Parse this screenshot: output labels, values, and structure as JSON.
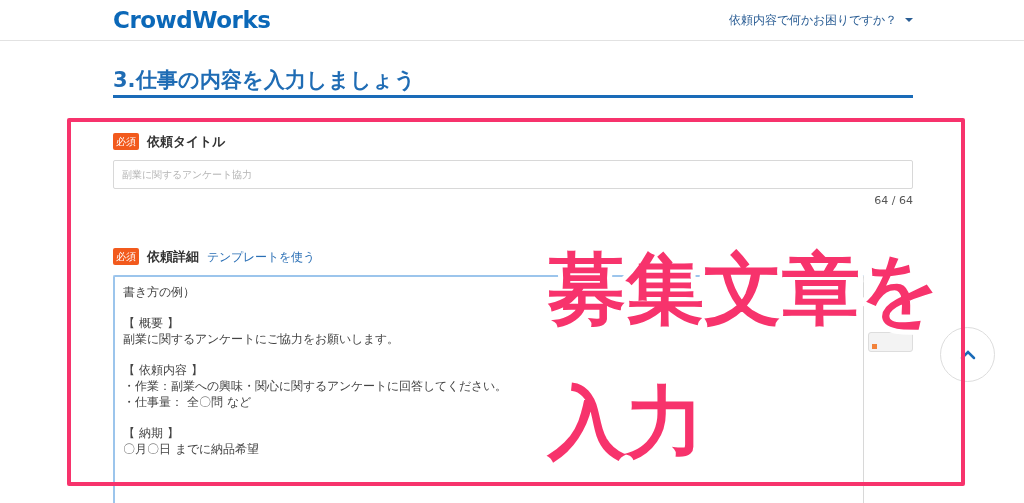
{
  "header": {
    "logo": "CrowdWorks",
    "help_menu": "依頼内容で何かお困りですか？"
  },
  "heading": "3.仕事の内容を入力しましょう",
  "fields": [
    {
      "kind": "input",
      "required_badge": "必須",
      "label": "依頼タイトル",
      "placeholder": "副業に関するアンケート協力",
      "counter": "64 / 64"
    },
    {
      "kind": "textarea",
      "required_badge": "必須",
      "label": "依頼詳細",
      "link": "テンプレートを使う",
      "paragraphs": [
        [
          "書き方の例）"
        ],
        [
          "【 概要 】",
          "副業に関するアンケートにご協力をお願いします。"
        ],
        [
          "【 依頼内容 】",
          "・作業：副業への興味・関心に関するアンケートに回答してください。",
          "・仕事量： 全〇問 など"
        ],
        [
          "【 納期 】",
          "〇月〇日 までに納品希望"
        ]
      ]
    }
  ],
  "annotation": {
    "lines": [
      "募集文章を",
      "入力"
    ]
  }
}
